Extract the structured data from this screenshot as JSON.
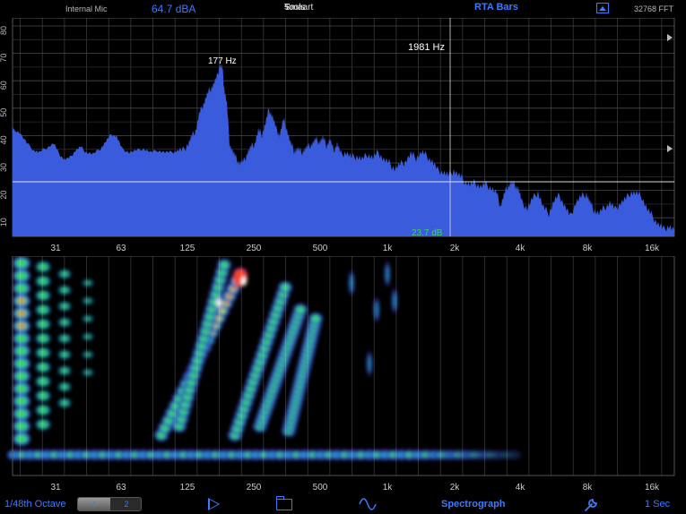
{
  "header": {
    "input": "Internal Mic",
    "level": "64.7 dBA",
    "brand_left": "Smaart",
    "brand_bolt": "ϟ",
    "brand_right": "Tools",
    "mode": "RTA Bars",
    "fft": "32768 FFT",
    "icon": "photo-icon"
  },
  "rta": {
    "y_ticks": [
      "80",
      "70",
      "60",
      "50",
      "40",
      "30",
      "20",
      "10"
    ],
    "x_ticks": [
      "31",
      "63",
      "125",
      "250",
      "500",
      "1k",
      "2k",
      "4k",
      "8k",
      "16k"
    ],
    "peak_label": "177 Hz",
    "cursor_label": "1981 Hz",
    "cursor_level": "23.7 dB",
    "colors": {
      "bars": "#3a5cdc",
      "grid": "#3a3a3a",
      "cursor": "#dddddd",
      "level_text": "#3cd85a"
    }
  },
  "spectrograph": {
    "x_ticks": [
      "31",
      "63",
      "125",
      "250",
      "500",
      "1k",
      "2k",
      "4k",
      "8k",
      "16k"
    ]
  },
  "footer": {
    "octave": "1/48th Octave",
    "seg1": "1",
    "seg2": "2",
    "view": "Spectrograph",
    "rate": "1 Sec",
    "icons": [
      "play-icon",
      "folder-icon",
      "wave-icon",
      "wrench-icon"
    ]
  }
}
